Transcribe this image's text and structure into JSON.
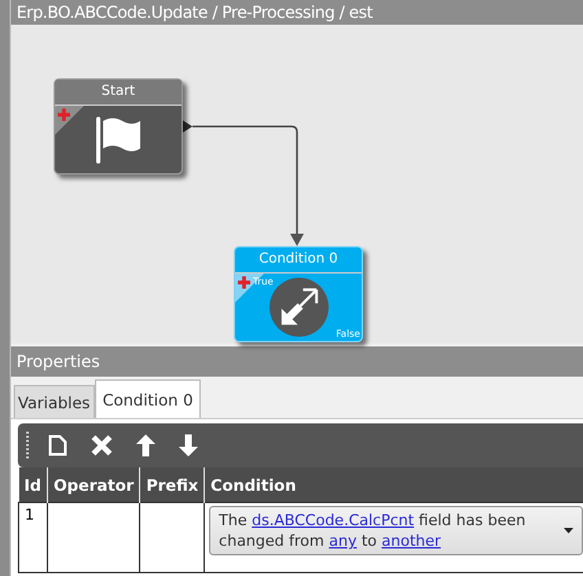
{
  "title": "Erp.BO.ABCCode.Update / Pre-Processing / est",
  "nodes": [
    {
      "kind": "start",
      "title": "Start"
    },
    {
      "kind": "condition",
      "title": "Condition 0",
      "true_label": "True",
      "false_label": "False"
    }
  ],
  "properties": {
    "title": "Properties"
  },
  "tabs": [
    {
      "label": "Variables",
      "selected": false
    },
    {
      "label": "Condition 0",
      "selected": true
    }
  ],
  "table": {
    "columns": [
      "Id",
      "Operator",
      "Prefix",
      "Condition"
    ],
    "rows": [
      {
        "id": "1",
        "operator": "",
        "prefix": "",
        "condition": [
          {
            "kind": "text",
            "text": "The "
          },
          {
            "kind": "link",
            "text": "ds.ABCCode.CalcPcnt"
          },
          {
            "kind": "text",
            "text": " field has been changed from "
          },
          {
            "kind": "link",
            "text": "any"
          },
          {
            "kind": "text",
            "text": " to "
          },
          {
            "kind": "link",
            "text": "another"
          }
        ]
      }
    ]
  }
}
